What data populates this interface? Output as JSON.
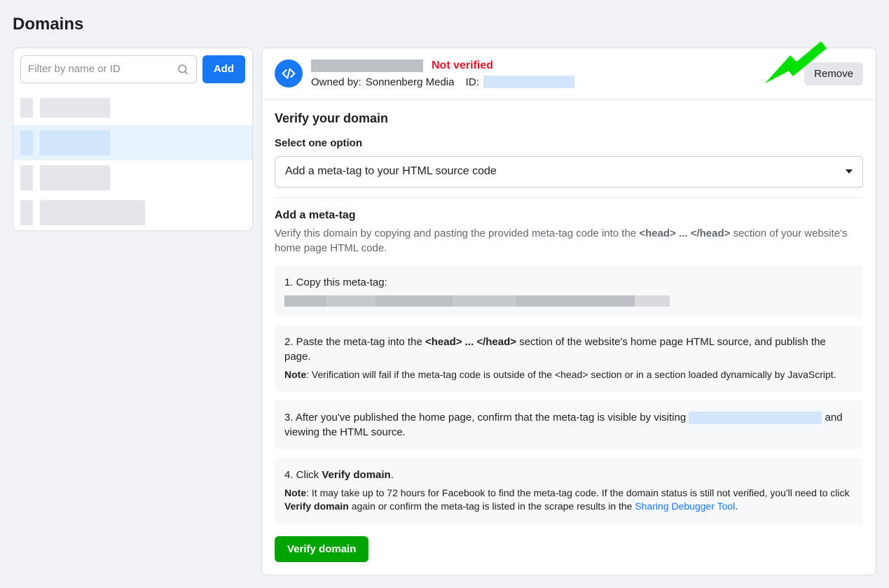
{
  "page": {
    "title": "Domains"
  },
  "sidebar": {
    "search_placeholder": "Filter by name or ID",
    "add_button_label": "Add"
  },
  "detail": {
    "status_label": "Not verified",
    "owned_by_prefix": "Owned by:",
    "owned_by_value": "Sonnenberg Media",
    "id_prefix": "ID:",
    "remove_label": "Remove",
    "verify_title": "Verify your domain",
    "select_label": "Select one option",
    "dropdown_selected": "Add a meta-tag to your HTML source code",
    "meta_title": "Add a meta-tag",
    "meta_desc_pre": "Verify this domain by copying and pasting the provided meta-tag code into the ",
    "meta_desc_bold": "<head> ... </head>",
    "meta_desc_post": " section of your website's home page HTML code.",
    "step1": "1. Copy this meta-tag:",
    "step2_pre": "2. Paste the meta-tag into the ",
    "step2_bold": "<head> ... </head>",
    "step2_post": " section of the website's home page HTML source, and publish the page.",
    "step2_note_label": "Note",
    "step2_note_text": ": Verification will fail if the meta-tag code is outside of the <head> section or in a section loaded dynamically by JavaScript.",
    "step3_pre": "3. After you've published the home page, confirm that the meta-tag is visible by visiting ",
    "step3_post": " and viewing the HTML source.",
    "step4_pre": "4. Click ",
    "step4_bold": "Verify domain",
    "step4_post": ".",
    "step4_note_label": "Note",
    "step4_note_text_pre": ": It may take up to 72 hours for Facebook to find the meta-tag code. If the domain status is still not verified, you'll need to click ",
    "step4_note_bold": "Verify domain",
    "step4_note_text_mid": " again or confirm the meta-tag is listed in the scrape results in the ",
    "step4_note_link": "Sharing Debugger Tool",
    "step4_note_text_post": ".",
    "verify_button_label": "Verify domain"
  }
}
